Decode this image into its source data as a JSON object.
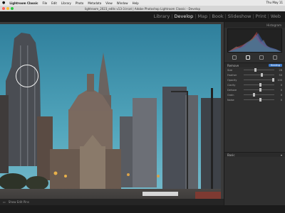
{
  "menubar": {
    "app": "Lightroom Classic",
    "items": [
      "File",
      "Edit",
      "Library",
      "Photo",
      "Metadata",
      "View",
      "Window",
      "Help"
    ],
    "clock": "Thu May 11"
  },
  "window": {
    "title": "lightroom_2023_edits v13-3.lrcat | Adobe Photoshop Lightroom Classic - Develop"
  },
  "modules": {
    "items": [
      {
        "label": "Library",
        "active": false
      },
      {
        "label": "Develop",
        "active": true
      },
      {
        "label": "Map",
        "active": false
      },
      {
        "label": "Book",
        "active": false
      },
      {
        "label": "Slideshow",
        "active": false
      },
      {
        "label": "Print",
        "active": false
      },
      {
        "label": "Web",
        "active": false
      }
    ]
  },
  "panel": {
    "header": "Histogram",
    "section": "Remove",
    "section_value": "Heal",
    "rows": [
      {
        "label": "Size",
        "value": "28",
        "level": 0.35
      },
      {
        "label": "Feather",
        "value": "50",
        "level": 0.55
      },
      {
        "label": "Opacity",
        "value": "100",
        "level": 0.95
      },
      {
        "label": "Clarity",
        "value": "0",
        "level": 0.5
      },
      {
        "label": "Dehaze",
        "value": "0",
        "level": 0.5
      },
      {
        "label": "Grain",
        "value": "0",
        "level": 0.3
      },
      {
        "label": "Noise",
        "value": "0",
        "level": 0.5
      }
    ],
    "brush_button": "Healing",
    "basic_section": "Basic",
    "footer": {
      "left": "Previous",
      "right": "Reset"
    }
  },
  "toolbar": {
    "label": "Show Edit Pins"
  },
  "colors": {
    "accent": "#3b78c8",
    "sky": "#4b98b2",
    "panel": "#2f2f2f"
  }
}
